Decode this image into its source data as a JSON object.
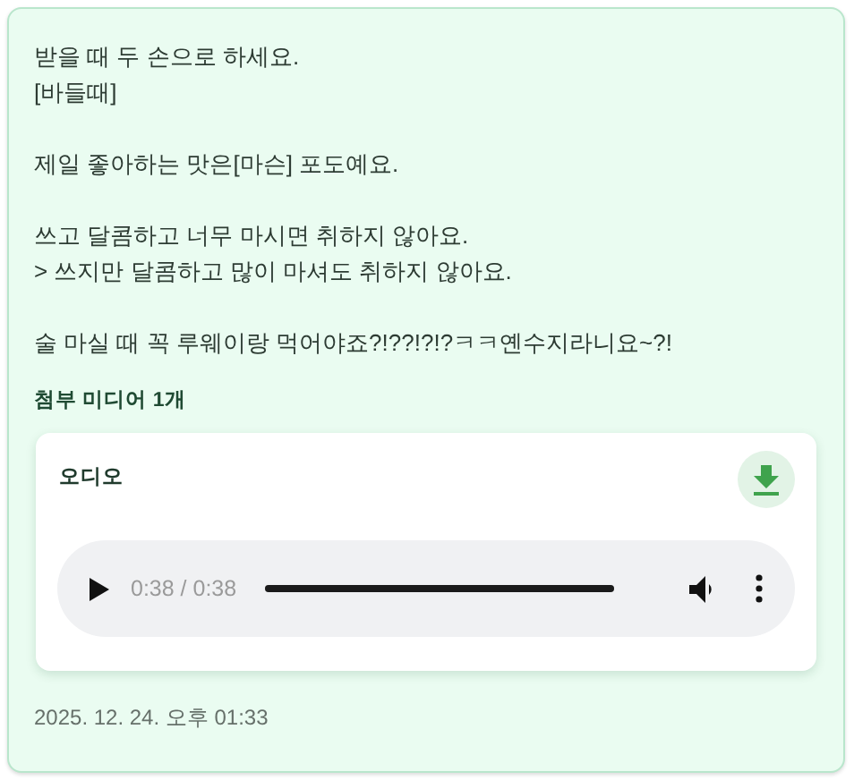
{
  "message": {
    "text": "받을 때 두 손으로 하세요.\n[바들때]\n\n제일 좋아하는 맛은[마슨] 포도예요.\n\n쓰고 달콤하고 너무 마시면 취하지 않아요.\n> 쓰지만 달콤하고 많이 마셔도 취하지 않아요.\n\n술 마실 때 꼭 루웨이랑 먹어야죠?!??!?!?ㅋㅋ옌수지라니요~?!"
  },
  "attachments": {
    "heading": "첨부 미디어 1개",
    "items": [
      {
        "kind": "audio",
        "title": "오디오",
        "time": "0:38 / 0:38",
        "level": 1.0
      }
    ]
  },
  "timestamp": "2025. 12. 24. 오후 01:33"
}
